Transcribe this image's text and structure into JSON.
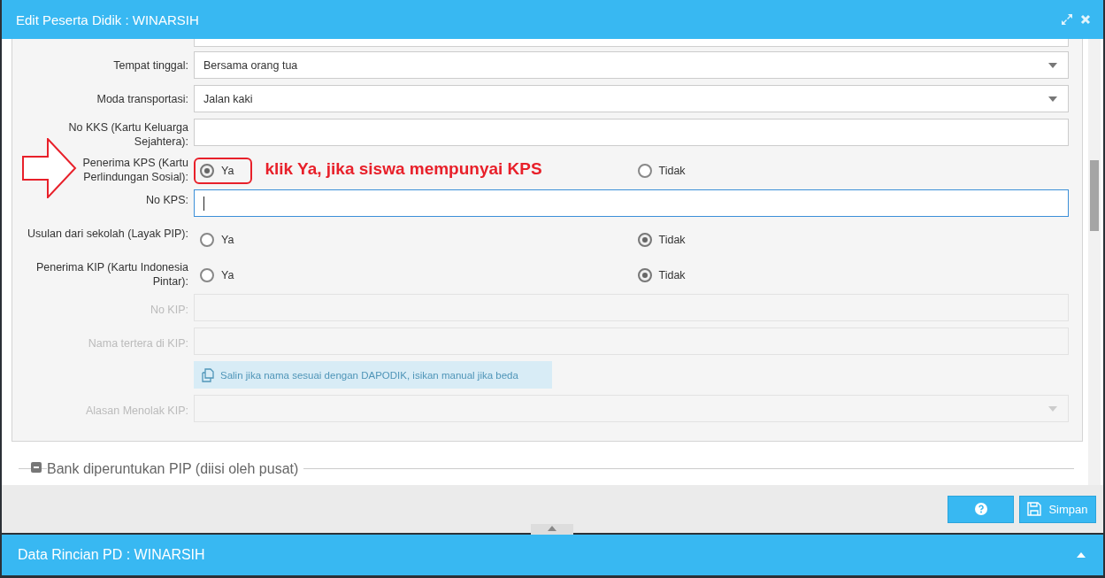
{
  "window": {
    "title": "Edit Peserta Didik : WINARSIH"
  },
  "fields": [
    {
      "kind": "select",
      "label": "Tempat tinggal:",
      "value": "Bersama orang tua",
      "disabled": false
    },
    {
      "kind": "select",
      "label": "Moda transportasi:",
      "value": "Jalan kaki",
      "disabled": false
    },
    {
      "kind": "text",
      "label": "No KKS (Kartu Keluarga Sejahtera):",
      "disabled": false,
      "focused": false
    },
    {
      "kind": "radio",
      "label": "Penerima KPS (Kartu Perlindungan Sosial):",
      "disabled": false,
      "annotation": "klik Ya, jika siswa mempunyai KPS",
      "options": [
        {
          "label": "Ya",
          "selected": true,
          "highlighted": true
        },
        {
          "label": "Tidak",
          "selected": false,
          "highlighted": false
        }
      ]
    },
    {
      "kind": "text",
      "label": "No KPS:",
      "disabled": false,
      "focused": true
    },
    {
      "kind": "radio",
      "label": "Usulan dari sekolah (Layak PIP):",
      "disabled": false,
      "options": [
        {
          "label": "Ya",
          "selected": false,
          "highlighted": false
        },
        {
          "label": "Tidak",
          "selected": true,
          "highlighted": false
        }
      ]
    },
    {
      "kind": "radio",
      "label": "Penerima KIP (Kartu Indonesia Pintar):",
      "disabled": false,
      "options": [
        {
          "label": "Ya",
          "selected": false,
          "highlighted": false
        },
        {
          "label": "Tidak",
          "selected": true,
          "highlighted": false
        }
      ]
    },
    {
      "kind": "text",
      "label": "No KIP:",
      "disabled": true,
      "focused": false
    },
    {
      "kind": "text",
      "label": "Nama tertera di KIP:",
      "disabled": true,
      "focused": false
    },
    {
      "kind": "button",
      "label": "Salin jika nama sesuai dengan DAPODIK, isikan manual jika beda",
      "disabled": true
    },
    {
      "kind": "select",
      "label": "Alasan Menolak KIP:",
      "disabled": true
    }
  ],
  "section": {
    "title": "Bank diperuntukan PIP (diisi oleh pusat)",
    "expanded": true
  },
  "footer": {
    "save": "Simpan"
  },
  "bottom_panel": {
    "title": "Data Rincian PD : WINARSIH"
  }
}
